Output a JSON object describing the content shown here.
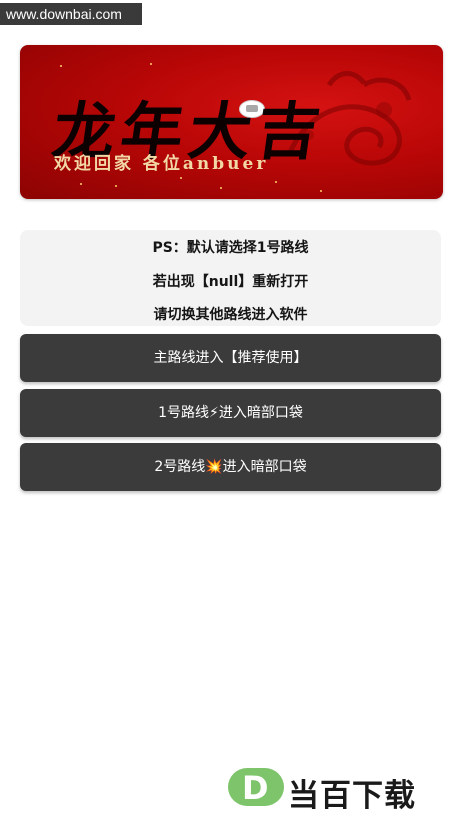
{
  "watermark": {
    "site": "www.downbai.com"
  },
  "banner": {
    "title": "龙年大吉",
    "subtitle": "欢迎回家  各位anbuer",
    "colors": {
      "background": "#c00808",
      "title": "#0d0000",
      "subtitle": "#f2d8a4"
    }
  },
  "notice": {
    "lines": [
      "PS：默认请选择1号路线",
      "若出现【null】重新打开",
      "请切换其他路线进入软件"
    ]
  },
  "routes": [
    {
      "label": "主路线进入【推荐使用】",
      "emoji": ""
    },
    {
      "label_prefix": "1号路线",
      "emoji": "⚡",
      "label_suffix": "进入暗部口袋"
    },
    {
      "label_prefix": "2号路线",
      "emoji": "💥",
      "label_suffix": "进入暗部口袋"
    }
  ],
  "brand": {
    "letter": "D",
    "name": "当百下载",
    "color": "#7ec46b"
  }
}
